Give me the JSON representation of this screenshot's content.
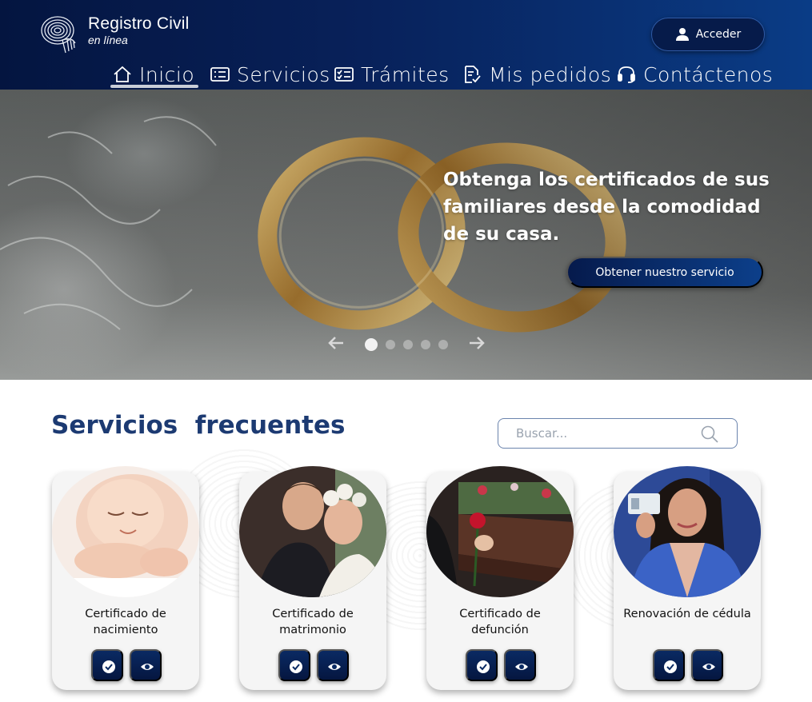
{
  "header": {
    "logo_title": "Registro Civil",
    "logo_subtitle": "en línea",
    "login_label": "Acceder",
    "login_icon": "user-icon"
  },
  "nav": {
    "active_index": 0,
    "items": [
      {
        "label": "Inicio",
        "icon": "home-icon"
      },
      {
        "label": "Servicios",
        "icon": "list-card-icon"
      },
      {
        "label": "Trámites",
        "icon": "checklist-icon"
      },
      {
        "label": "Mis pedidos",
        "icon": "document-check-icon"
      },
      {
        "label": "Contáctenos",
        "icon": "headset-icon"
      }
    ]
  },
  "hero": {
    "headline": "Obtenga los certificados de sus familiares desde la comodidad de su casa.",
    "cta_label": "Obtener nuestro servicio",
    "slides_count": 5,
    "active_slide": 0
  },
  "services": {
    "title": "Servicios  frecuentes",
    "search_placeholder": "Buscar...",
    "search_value": "",
    "cards": [
      {
        "title": "Certificado de nacimiento",
        "image": "newborn-baby-photo",
        "action_icons": [
          "check-circle-icon",
          "eye-icon"
        ]
      },
      {
        "title": "Certificado de matrimonio",
        "image": "wedding-couple-photo",
        "action_icons": [
          "check-circle-icon",
          "eye-icon"
        ]
      },
      {
        "title": "Certificado de defunción",
        "image": "funeral-rose-photo",
        "action_icons": [
          "check-circle-icon",
          "eye-icon"
        ]
      },
      {
        "title": "Renovación de cédula",
        "image": "woman-with-id-card-photo",
        "action_icons": [
          "check-circle-icon",
          "eye-icon"
        ]
      }
    ]
  },
  "colors": {
    "header_dark": "#041540",
    "header_light": "#0a3c86",
    "title_blue": "#1c3a72",
    "button_navy": "#061b4a"
  }
}
